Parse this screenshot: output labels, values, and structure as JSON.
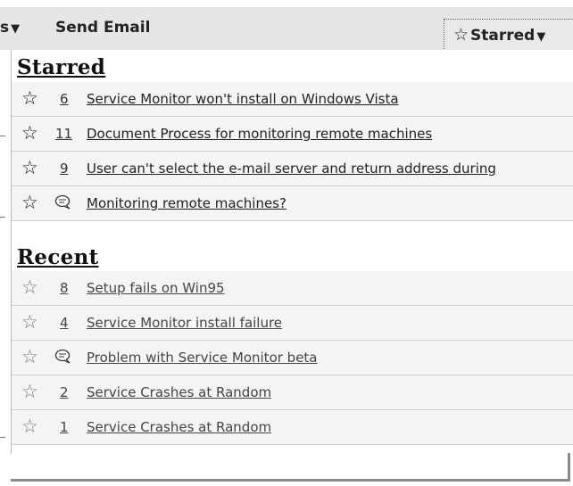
{
  "toolbar": {
    "partial_label": "s",
    "dropdown_arrow": "▼",
    "send_email": "Send Email",
    "starred_star": "☆",
    "starred_label": "Starred",
    "starred_arrow": "▼"
  },
  "starred": {
    "heading": "Starred",
    "items": [
      {
        "star": "☆",
        "num": "6",
        "title": "Service Monitor won't install on Windows Vista"
      },
      {
        "star": "☆",
        "num": "11",
        "title": "Document Process for monitoring remote machines"
      },
      {
        "star": "☆",
        "num": "9",
        "title": "User can't select the e-mail server and return address during"
      },
      {
        "star": "☆",
        "icon": "discussion-icon",
        "title": "Monitoring remote machines?"
      }
    ]
  },
  "recent": {
    "heading": "Recent",
    "items": [
      {
        "star": "☆",
        "num": "8",
        "title": "Setup fails on Win95"
      },
      {
        "star": "☆",
        "num": "4",
        "title": "Service Monitor install failure"
      },
      {
        "star": "☆",
        "icon": "discussion-icon",
        "title": "Problem with Service Monitor beta"
      },
      {
        "star": "☆",
        "num": "2",
        "title": "Service Crashes at Random"
      },
      {
        "star": "☆",
        "num": "1",
        "title": "Service Crashes at Random"
      }
    ]
  },
  "colors": {
    "toolbar_bg": "#e6e6e6",
    "row_bg": "#f4f4f4",
    "row_border": "#cfcfcf"
  }
}
